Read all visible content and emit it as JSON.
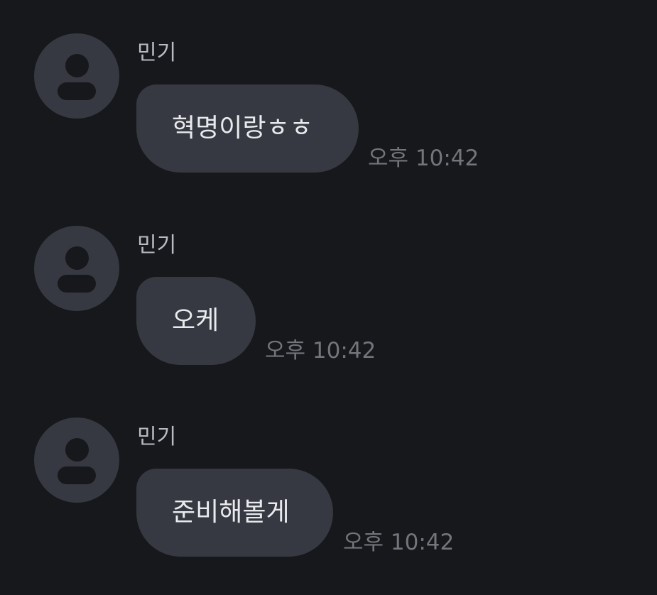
{
  "messages": [
    {
      "sender": "민기",
      "text": "혁명이랑ㅎㅎ",
      "time": "오후 10:42"
    },
    {
      "sender": "민기",
      "text": "오케",
      "time": "오후 10:42"
    },
    {
      "sender": "민기",
      "text": "준비해볼게",
      "time": "오후 10:42"
    }
  ],
  "colors": {
    "background": "#17181c",
    "bubble": "#363941",
    "bubble_text": "#e9eaee",
    "sender_text": "#b8bbc3",
    "time_text": "#72757c",
    "avatar": "#363941"
  },
  "icons": {
    "avatar": "default-profile-icon"
  }
}
